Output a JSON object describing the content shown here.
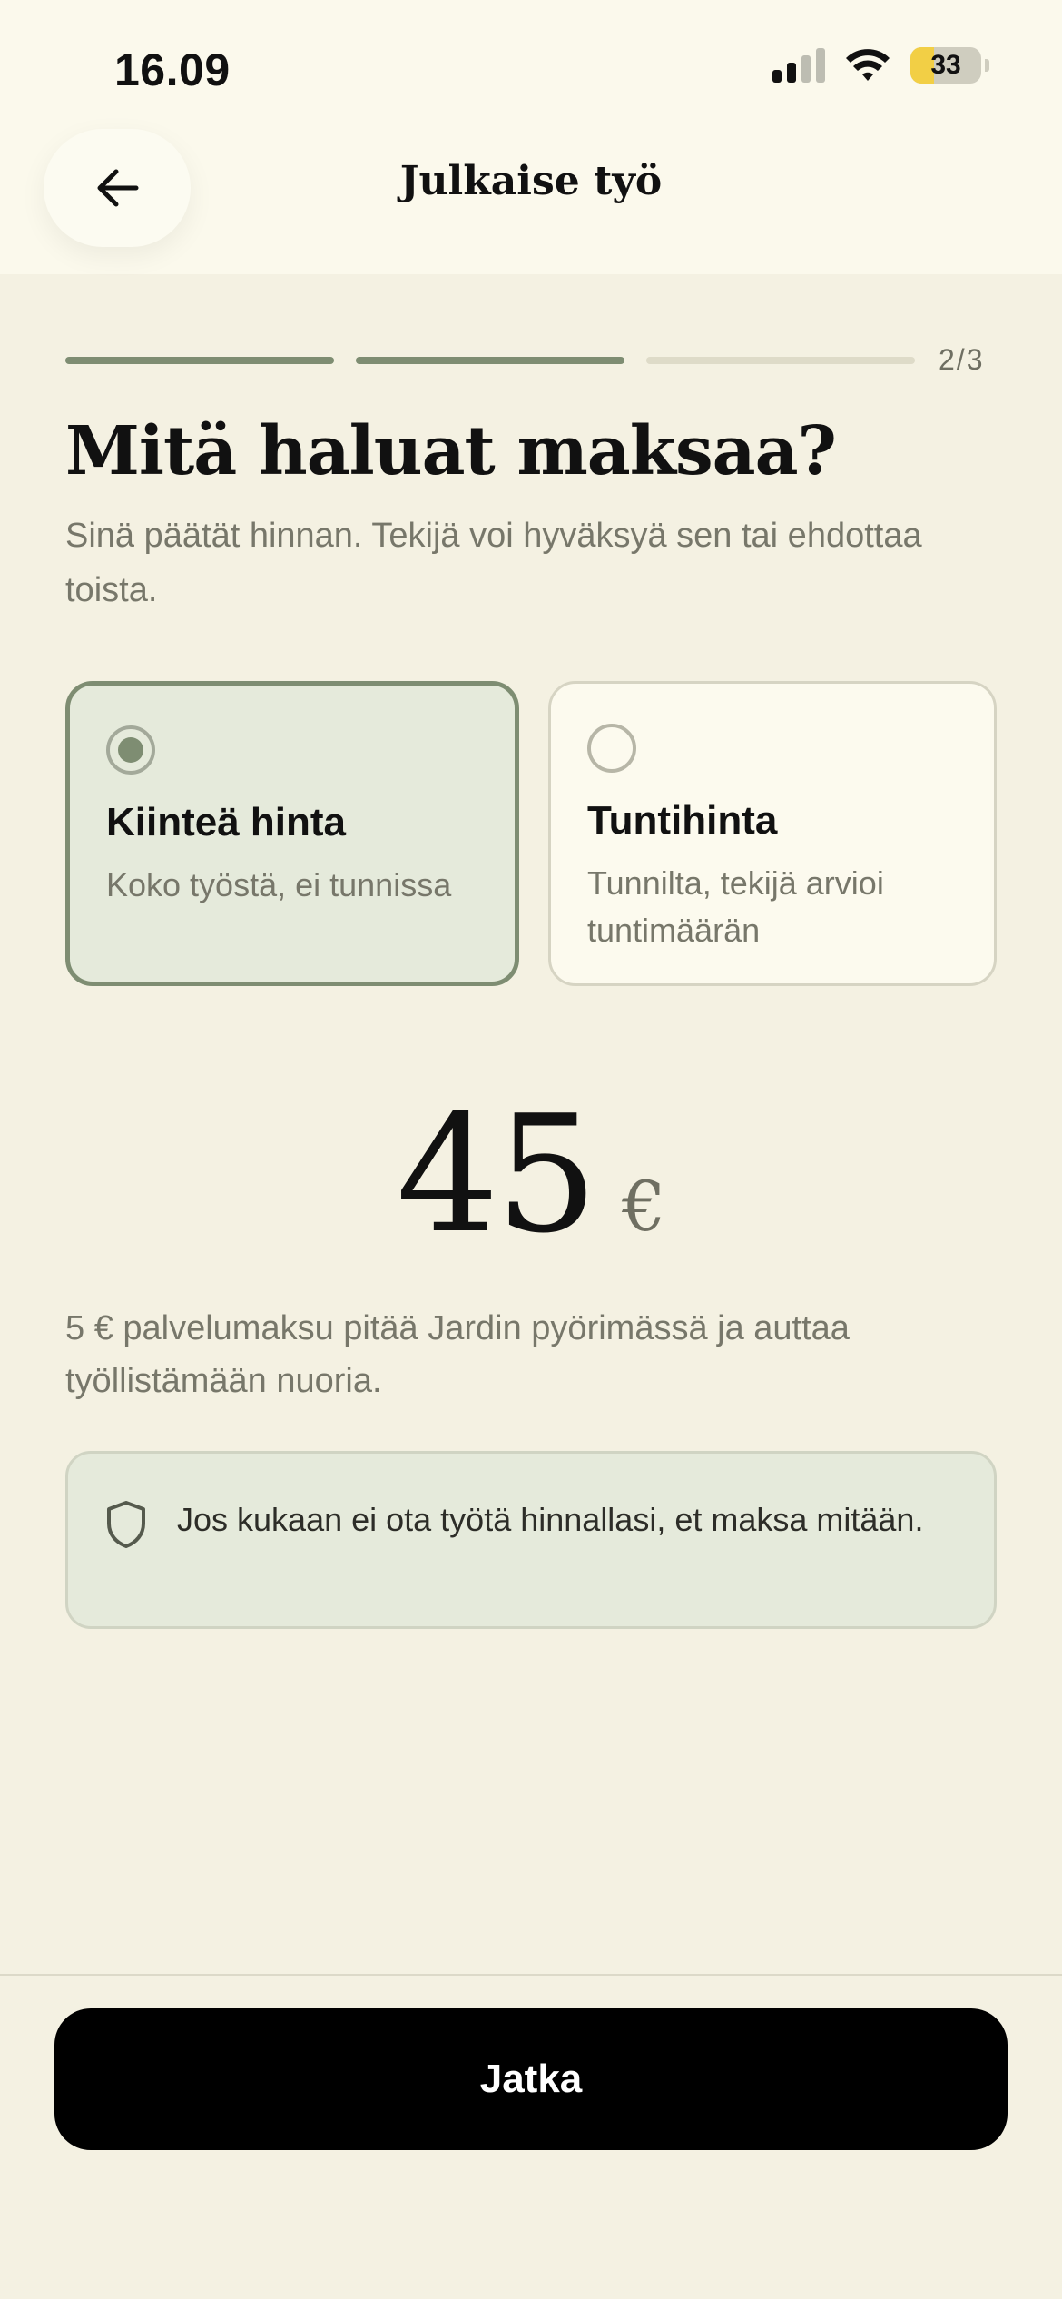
{
  "status_bar": {
    "time": "16.09",
    "battery": "33",
    "battery_level": 0.33
  },
  "header": {
    "title": "Julkaise työ",
    "back_icon": "arrow-left-icon"
  },
  "progress": {
    "current": 2,
    "total": 3,
    "label": "2/3"
  },
  "page": {
    "heading": "Mitä haluat maksaa?",
    "subtitle": "Sinä päätät hinnan. Tekijä voi hyväksyä sen tai ehdottaa toista."
  },
  "price_type": {
    "selected": "fixed",
    "options": [
      {
        "id": "fixed",
        "title": "Kiinteä hinta",
        "description": "Koko työstä, ei tunnissa"
      },
      {
        "id": "hourly",
        "title": "Tuntihinta",
        "description": "Tunnilta, tekijä arvioi tuntimäärän"
      }
    ]
  },
  "price": {
    "amount": "45",
    "currency": "€"
  },
  "fee_note": "5 € palvelumaksu pitää Jardin pyörimässä ja auttaa työllistämään nuoria.",
  "guarantee": {
    "icon": "shield-icon",
    "text": "Jos kukaan ei ota työtä hinnallasi, et maksa mitään."
  },
  "cta": {
    "label": "Jatka"
  },
  "colors": {
    "background": "#f4f1e2",
    "accent": "#7e8d72",
    "selected_bg": "#e5eadb",
    "button": "#000000"
  }
}
